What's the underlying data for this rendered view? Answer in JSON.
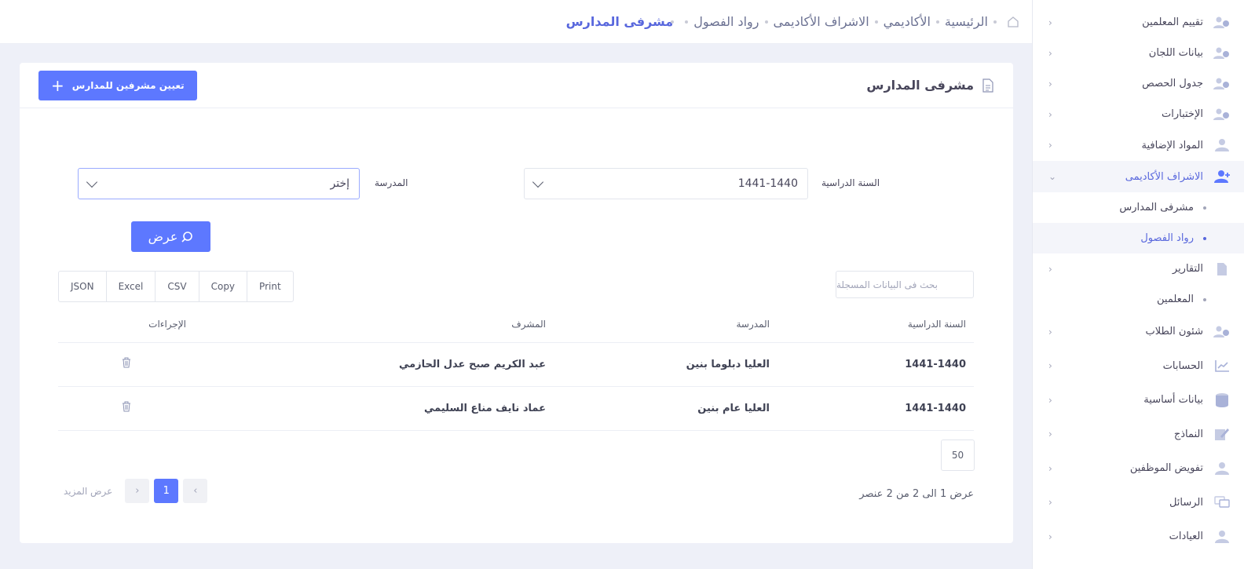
{
  "breadcrumb": {
    "items": [
      "الرئيسية",
      "الأكاديمي",
      "الاشراف الأكاديمى",
      "رواد الفصول"
    ],
    "current": "مشرفى المدارس"
  },
  "card": {
    "title": "مشرفى المدارس",
    "assign_button": "تعيين مشرفين للمدارس"
  },
  "filters": {
    "year_label": "السنة الدراسية",
    "year_value": "1441-1440",
    "school_label": "المدرسة",
    "school_value": "إختر",
    "show_button": "عرض"
  },
  "table": {
    "search_placeholder": "بحث فى البيانات المسجلة",
    "export": [
      "Print",
      "Copy",
      "CSV",
      "Excel",
      "JSON"
    ],
    "headers": [
      "السنة الدراسية",
      "المدرسة",
      "المشرف",
      "الإجراءات"
    ],
    "rows": [
      {
        "year": "1441-1440",
        "school": "العليا دبلوما بنين",
        "supervisor": "عبد الكريم صبح عدل الحازمي"
      },
      {
        "year": "1441-1440",
        "school": "العليا عام بنين",
        "supervisor": "عماد نايف مناع السليمي"
      }
    ],
    "page_size": "50",
    "info": "عرض 1 الى 2 من 2 عنصر",
    "more": "عرض المزيد",
    "current_page": "1"
  },
  "sidebar": {
    "items": [
      {
        "label": "تقييم المعلمين",
        "icon": "users-gear-icon"
      },
      {
        "label": "بيانات اللجان",
        "icon": "users-gear-icon"
      },
      {
        "label": "جدول الحصص",
        "icon": "users-gear-icon"
      },
      {
        "label": "الإختبارات",
        "icon": "users-gear-icon"
      },
      {
        "label": "المواد الإضافية",
        "icon": "user-icon"
      },
      {
        "label": "الاشراف الأكاديمى",
        "icon": "user-add-icon"
      },
      {
        "label": "مشرفى المدارس",
        "icon": "dot"
      },
      {
        "label": "رواد الفصول",
        "icon": "dot"
      },
      {
        "label": "التقارير",
        "icon": "file-icon"
      },
      {
        "label": "المعلمين",
        "icon": "dot"
      },
      {
        "label": "شئون الطلاب",
        "icon": "users-gear-icon"
      },
      {
        "label": "الحسابات",
        "icon": "chart-icon"
      },
      {
        "label": "بيانات أساسية",
        "icon": "database-icon"
      },
      {
        "label": "النماذج",
        "icon": "edit-icon"
      },
      {
        "label": "تفويض الموظفين",
        "icon": "user-icon"
      },
      {
        "label": "الرسائل",
        "icon": "chat-icon"
      },
      {
        "label": "العيادات",
        "icon": "user-icon"
      }
    ]
  },
  "colors": {
    "accent": "#5d78ff",
    "active_text": "#5867dd"
  }
}
